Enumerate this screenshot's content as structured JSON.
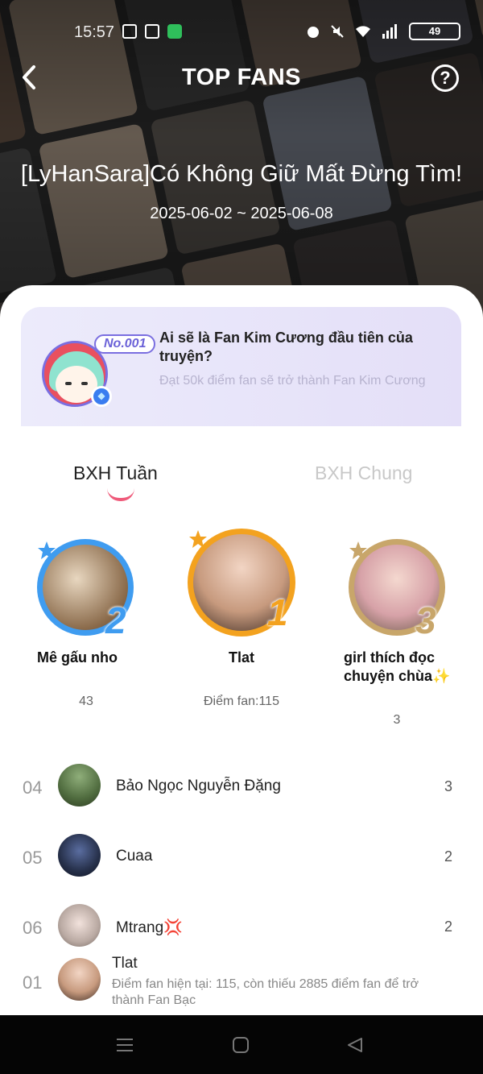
{
  "status_bar": {
    "time": "15:57",
    "battery": "49"
  },
  "header": {
    "title": "TOP FANS",
    "back_icon": "chevron-left-icon",
    "help_icon": "question-circle-icon"
  },
  "book": {
    "title": "[LyHanSara]Có Không Giữ Mất Đừng Tìm!",
    "date_range": "2025-06-02 ~ 2025-06-08"
  },
  "promo": {
    "badge": "No.001",
    "title": "Ai sẽ là Fan Kim Cương đầu tiên của truyện?",
    "subtitle": "Đạt 50k điểm fan sẽ trở thành Fan Kim Cương"
  },
  "tabs": [
    {
      "label": "BXH Tuần",
      "active": true
    },
    {
      "label": "BXH Chung",
      "active": false
    }
  ],
  "podium": [
    {
      "rank": "2",
      "name": "Mê gấu nho",
      "score": "43",
      "ring_color": "#3f9cf0"
    },
    {
      "rank": "1",
      "name": "Tlat",
      "score": "Điểm fan:115",
      "ring_color": "#f3a21f"
    },
    {
      "rank": "3",
      "name": "girl thích đọc chuyện chùa✨",
      "score": "3",
      "ring_color": "#c8a66a"
    }
  ],
  "list": [
    {
      "rank": "04",
      "name": "Bảo Ngọc Nguyễn Đặng",
      "score": "3"
    },
    {
      "rank": "05",
      "name": "Cuaa",
      "score": "2"
    },
    {
      "rank": "06",
      "name": "Mtrang💢",
      "score": "2"
    }
  ],
  "my_rank": {
    "rank": "01",
    "name": "Tlat",
    "description": "Điểm fan hiện tại: 115, còn thiếu 2885 điểm fan để trở thành Fan Bạc"
  },
  "colors": {
    "accent": "#ef5a7a",
    "promo_purple": "#6b62d8"
  }
}
